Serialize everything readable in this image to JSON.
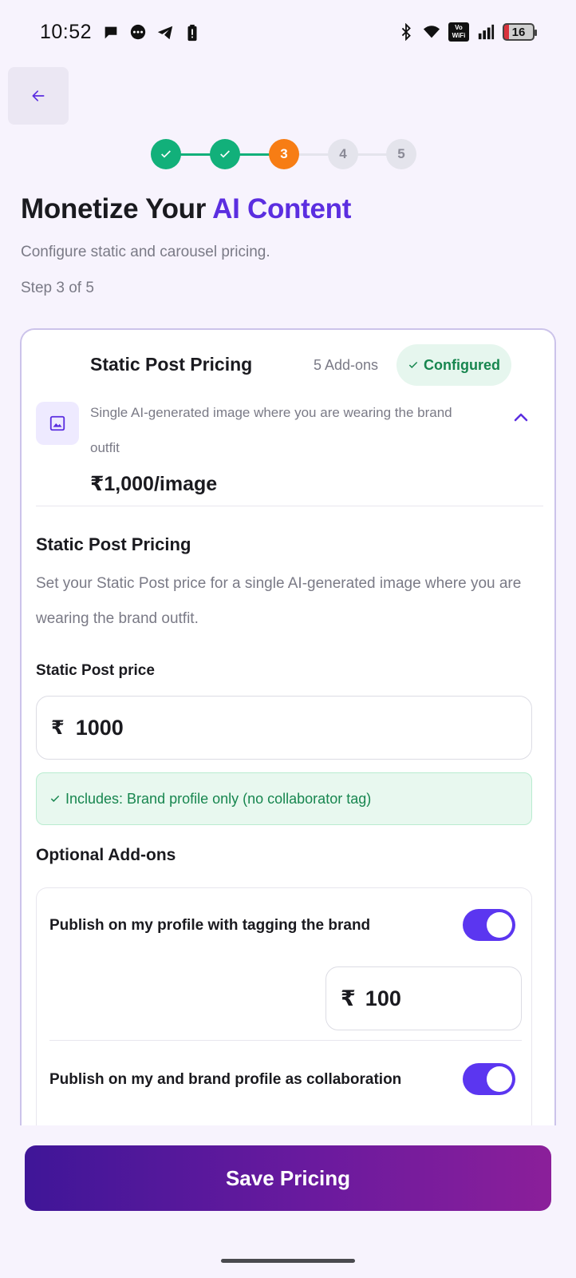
{
  "status_bar": {
    "time": "10:52",
    "left_icons": [
      "chat-bubble-icon",
      "message-icon",
      "telegram-icon",
      "alert-battery-icon"
    ],
    "right_icons": [
      "bluetooth-icon",
      "wifi-icon",
      "vowifi-icon",
      "signal-icon",
      "battery-icon"
    ],
    "vowifi_text": "Vo WiFi",
    "battery_level": "16"
  },
  "header": {
    "back_icon": "arrow-left-icon"
  },
  "stepper": {
    "steps": [
      {
        "label": "",
        "state": "done"
      },
      {
        "label": "",
        "state": "done"
      },
      {
        "label": "3",
        "state": "active"
      },
      {
        "label": "4",
        "state": "todo"
      },
      {
        "label": "5",
        "state": "todo"
      }
    ]
  },
  "page": {
    "title_prefix": "Monetize Your ",
    "title_accent": "AI Content",
    "subtitle": "Configure static and carousel pricing.",
    "step_text": "Step 3 of 5"
  },
  "card": {
    "title": "Static Post Pricing",
    "addons_count": "5 Add-ons",
    "badge": "Configured",
    "description": "Single AI-generated image where you are wearing the brand outfit",
    "price": "₹1,000/image",
    "section_title": "Static Post Pricing",
    "section_desc": "Set your Static Post price for a single AI-generated image where you are wearing the brand outfit.",
    "field_label": "Static Post price",
    "currency": "₹",
    "price_value": "1000",
    "includes_text": "Includes: Brand profile only (no collaborator tag)",
    "optional_title": "Optional Add-ons",
    "addons": [
      {
        "label": "Publish on my profile with tagging the brand",
        "enabled": true,
        "currency": "₹",
        "price": "100"
      },
      {
        "label": "Publish on my and brand profile as collaboration",
        "enabled": true
      }
    ]
  },
  "footer": {
    "save_label": "Save Pricing"
  },
  "colors": {
    "accent": "#5b2ee0",
    "success": "#12b07a",
    "active_step": "#f77d14",
    "toggle_on": "#5b36f0"
  }
}
